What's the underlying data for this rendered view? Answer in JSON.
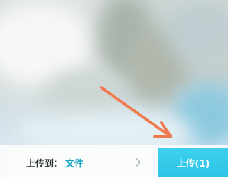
{
  "upload_bar": {
    "destination_label": "上传到：",
    "destination_folder": "文件",
    "chevron_icon": "chevron-right-icon",
    "upload_button_label": "上传(1)"
  },
  "colors": {
    "accent": "#2cc3e6",
    "folder_text": "#1aa6c6",
    "arrow": "#f07a4f"
  }
}
